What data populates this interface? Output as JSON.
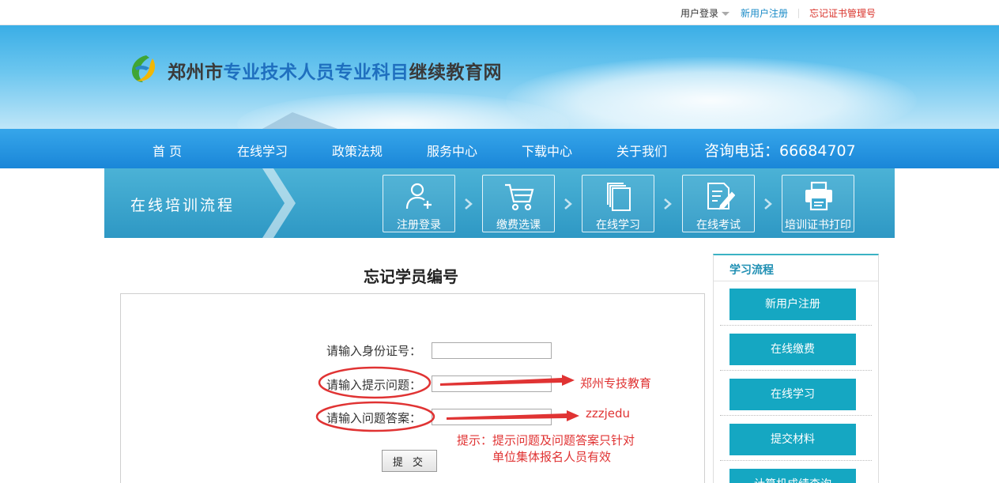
{
  "topbar": {
    "login_label": "用户登录",
    "register_label": "新用户注册",
    "forgot_label": "忘记证书管理号"
  },
  "header": {
    "title_prefix": "郑州市",
    "title_highlight": "专业技术人员专业科目",
    "title_suffix": "继续教育网"
  },
  "nav": {
    "items": [
      "首 页",
      "在线学习",
      "政策法规",
      "服务中心",
      "下载中心",
      "关于我们"
    ],
    "phone": "咨询电话：66684707"
  },
  "process": {
    "title": "在线培训流程",
    "steps": [
      {
        "label": "注册登录",
        "icon": "user-add-icon"
      },
      {
        "label": "缴费选课",
        "icon": "shopping-cart-icon"
      },
      {
        "label": "在线学习",
        "icon": "documents-icon"
      },
      {
        "label": "在线考试",
        "icon": "exam-edit-icon"
      },
      {
        "label": "培训证书打印",
        "icon": "printer-icon"
      }
    ]
  },
  "form": {
    "title": "忘记学员编号",
    "id_label": "请输入身份证号：",
    "question_label": "请输入提示问题：",
    "answer_label": "请输入问题答案：",
    "submit_label": "提 交",
    "annotation_question": "郑州专技教育",
    "annotation_answer": "zzzjedu",
    "hint_line1": "提示：提示问题及问题答案只针对",
    "hint_line2": "单位集体报名人员有效"
  },
  "sidebar": {
    "heading": "学习流程",
    "buttons": [
      "新用户注册",
      "在线缴费",
      "在线学习",
      "提交材料",
      "计算机成绩查询"
    ]
  },
  "colors": {
    "nav_blue": "#1a86d8",
    "process_blue": "#2e98c4",
    "sidebar_button": "#15a7c2",
    "annotation_red": "#e03333",
    "link_blue": "#1a8bc7",
    "link_red": "#d9322a"
  }
}
